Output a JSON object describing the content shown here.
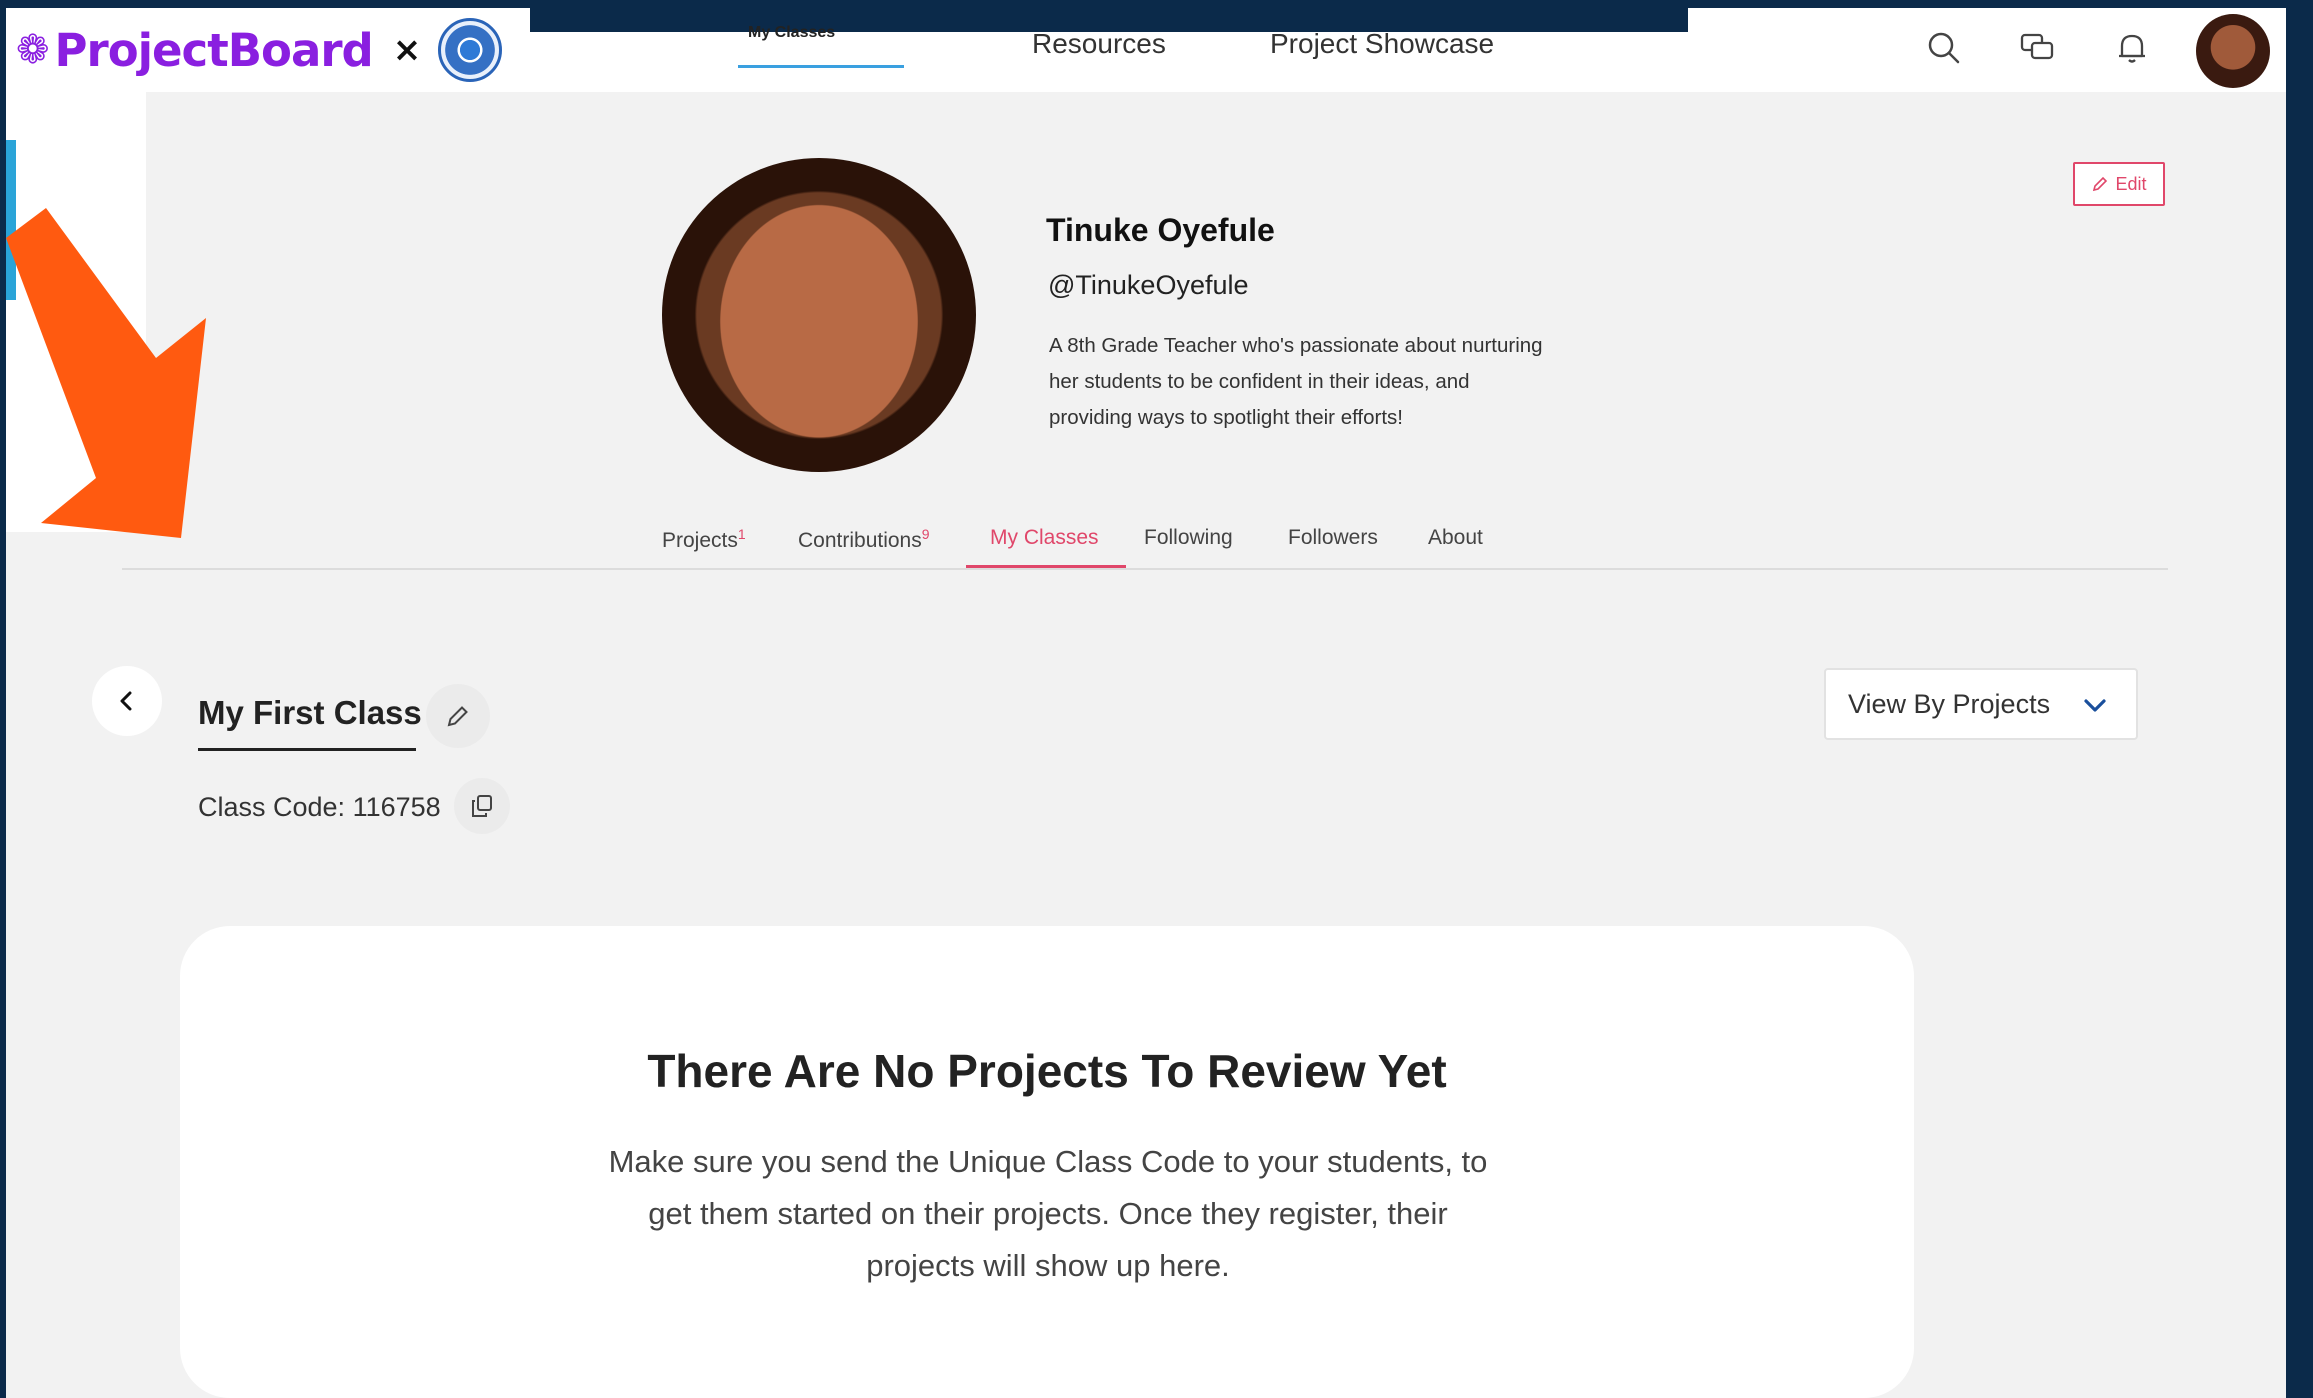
{
  "brand": {
    "name": "ProjectBoard",
    "separator": "×"
  },
  "nav": {
    "links": [
      "My Classes",
      "Resources",
      "Project Showcase"
    ],
    "active": "My Classes"
  },
  "header_icons": [
    "search-icon",
    "messages-icon",
    "bell-icon"
  ],
  "profile": {
    "name": "Tinuke Oyefule",
    "handle": "@TinukeOyefule",
    "bio": "A 8th Grade Teacher who's passionate about nurturing her students to be confident in their ideas, and providing ways to spotlight their efforts!",
    "bio_lines": [
      "A 8th Grade Teacher who's passionate about nurturing",
      "her students to be confident in their ideas, and",
      "providing ways to spotlight their efforts!"
    ],
    "edit_label": "Edit"
  },
  "tabs": [
    {
      "label": "Projects",
      "count": "1"
    },
    {
      "label": "Contributions",
      "count": "9"
    },
    {
      "label": "My Classes",
      "count": ""
    },
    {
      "label": "Following",
      "count": ""
    },
    {
      "label": "Followers",
      "count": ""
    },
    {
      "label": "About",
      "count": ""
    }
  ],
  "active_tab": "My Classes",
  "class": {
    "title": "My First Class",
    "code_text": "Class Code: 116758"
  },
  "view_select": {
    "value": "View By Projects"
  },
  "empty_state": {
    "title": "There Are No Projects To Review Yet",
    "lines": [
      "Make sure you send the Unique Class Code to your students, to",
      "get them started on their projects. Once they register, their",
      "projects will show up here."
    ]
  },
  "colors": {
    "brand_purple": "#8a1fe0",
    "accent_pink": "#e0476a",
    "frame_navy": "#0b2a4a",
    "arrow_orange": "#ff5a10",
    "nav_underline_blue": "#3aa0e0"
  }
}
